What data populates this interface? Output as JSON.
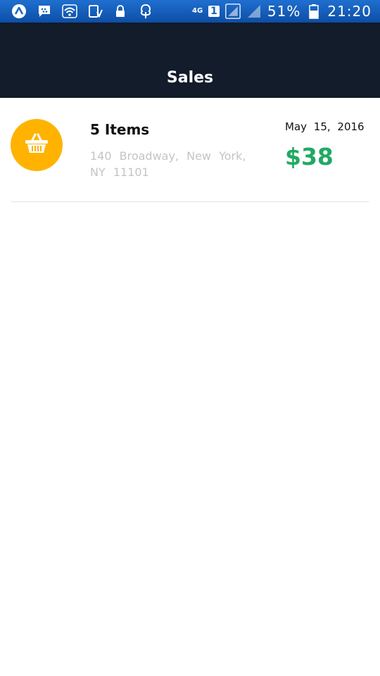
{
  "status_bar": {
    "battery": "51%",
    "time": "21:20",
    "network_label": "4G",
    "sim_label": "1",
    "icons": [
      "app-launcher-icon",
      "chat-icon",
      "wifi-icon",
      "device-download-icon",
      "lock-icon",
      "tree-icon",
      "signal-icon",
      "battery-icon"
    ]
  },
  "app_bar": {
    "title": "Sales"
  },
  "sales": [
    {
      "items": "5 Items",
      "address": "140 Broadway, New York, NY 11101",
      "date": "May 15, 2016",
      "amount": "$38",
      "icon": "basket-icon"
    }
  ],
  "colors": {
    "status_bar": "#1565c0",
    "app_bar": "#121c2a",
    "avatar": "#ffb300",
    "amount": "#21a963",
    "address": "#c4c4c4"
  }
}
